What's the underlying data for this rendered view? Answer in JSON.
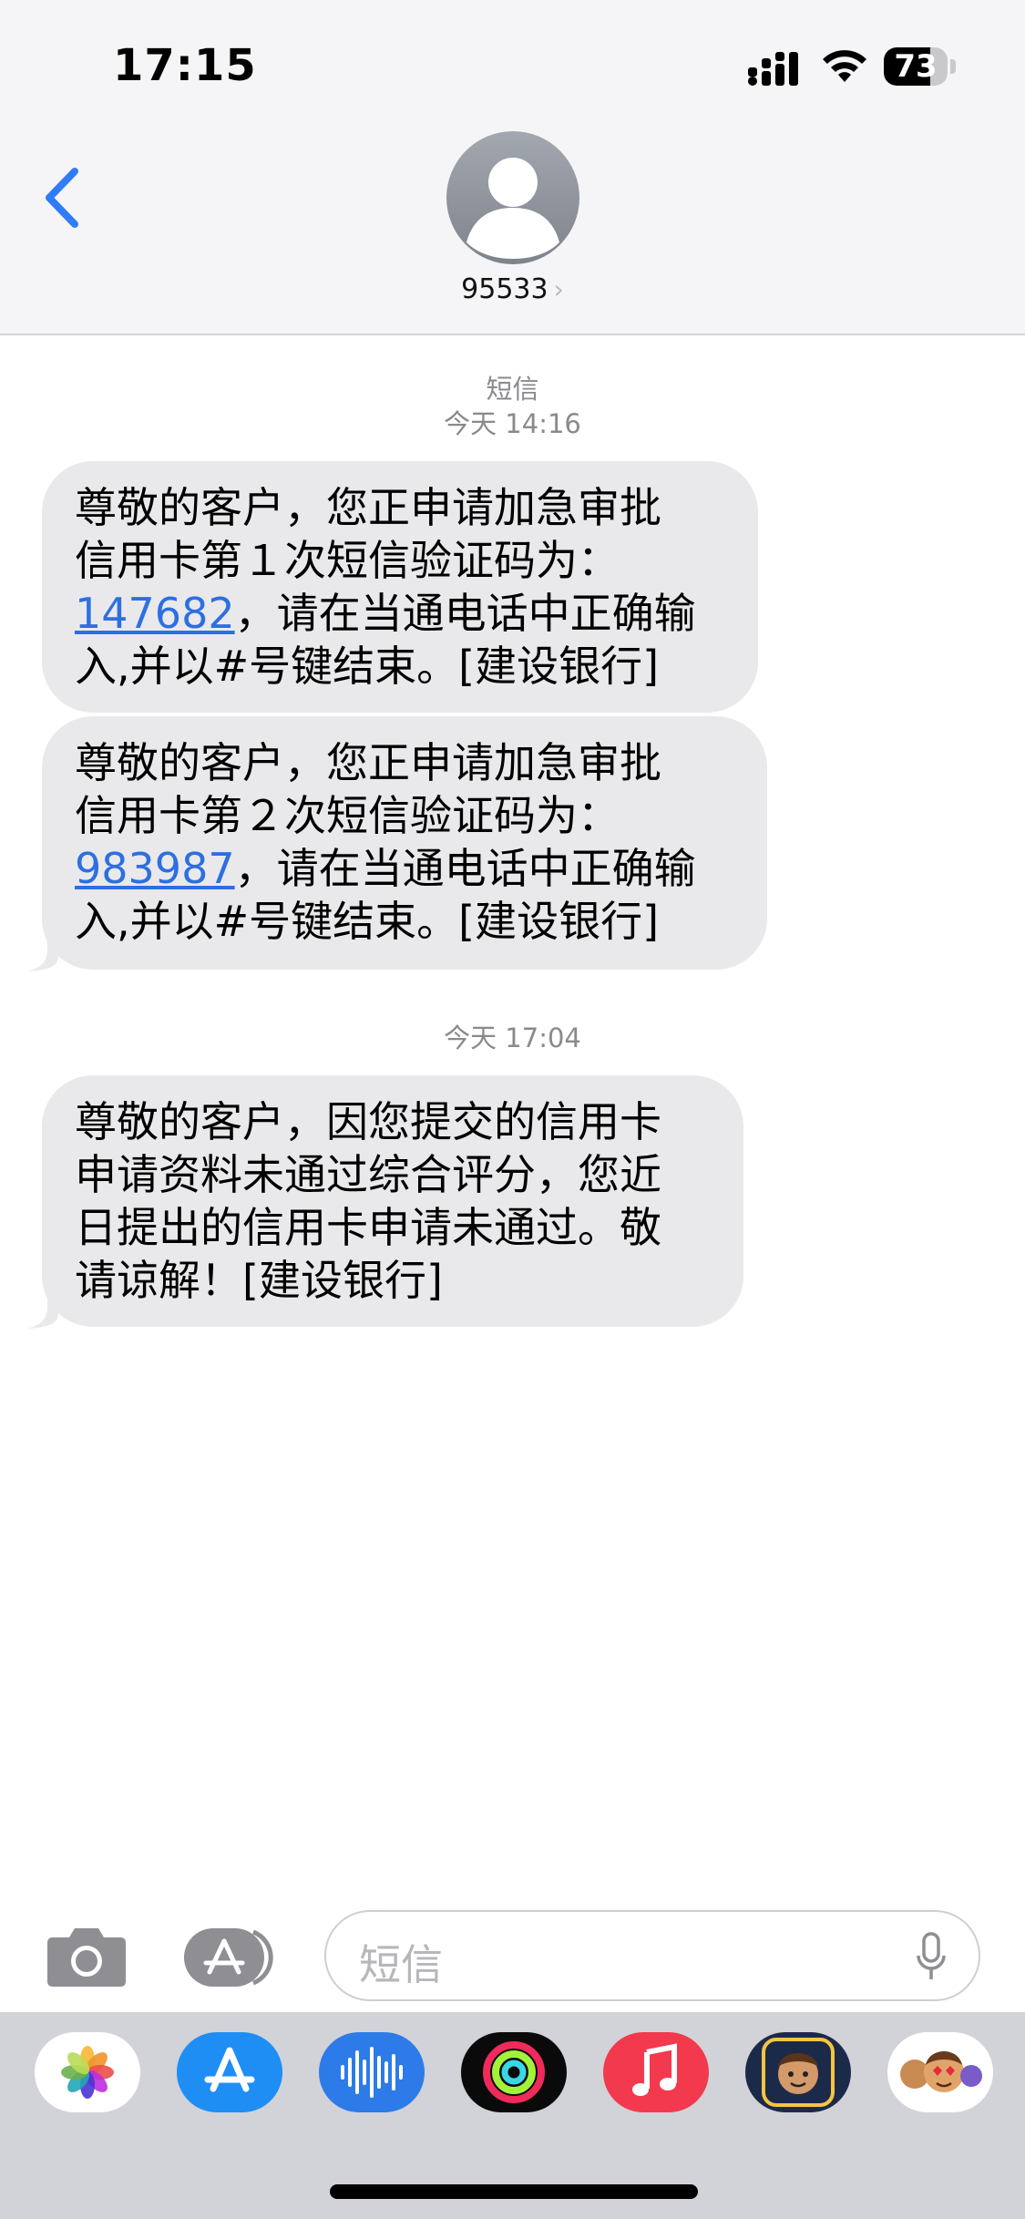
{
  "status_bar": {
    "time": "17:15",
    "battery": "73",
    "battery_level": 0.73
  },
  "header": {
    "contact": "95533",
    "chevron": "›"
  },
  "thread": {
    "service_label": "短信",
    "groups": [
      {
        "timestamp": "今天 14:16",
        "messages": [
          {
            "lines": [
              "尊敬的客户，您正申请加急审批",
              "信用卡第１次短信验证码为：",
              "",
              "入,并以#号键结束。[建设银行]"
            ],
            "code": "147682",
            "code_suffix": "，请在当通电话中正确输"
          },
          {
            "lines": [
              "尊敬的客户，您正申请加急审批",
              "信用卡第２次短信验证码为：",
              "",
              "入,并以#号键结束。[建设银行]"
            ],
            "code": "983987",
            "code_suffix": "，请在当通电话中正确输"
          }
        ]
      },
      {
        "timestamp": "今天 17:04",
        "messages": [
          {
            "lines": [
              "尊敬的客户，因您提交的信用卡",
              "申请资料未通过综合评分，您近",
              "日提出的信用卡申请未通过。敬",
              "请谅解！[建设银行]"
            ]
          }
        ]
      }
    ]
  },
  "composer": {
    "placeholder": "短信"
  },
  "icons": [
    "back-chevron-icon",
    "contact-avatar-icon",
    "camera-icon",
    "app-store-icon",
    "microphone-icon"
  ],
  "dock_apps": [
    "photos-app-icon",
    "app-store-app-icon",
    "audio-messages-app-icon",
    "activity-app-icon",
    "music-app-icon",
    "memoji-app-icon",
    "memoji-stickers-app-icon"
  ]
}
